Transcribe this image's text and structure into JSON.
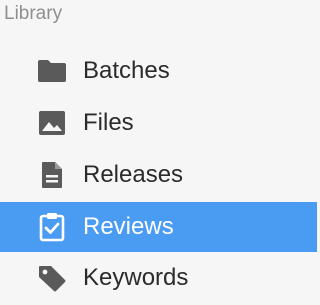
{
  "sidebar": {
    "section_title": "Library",
    "items": [
      {
        "label": "Batches",
        "icon": "folder-icon",
        "selected": false
      },
      {
        "label": "Files",
        "icon": "image-icon",
        "selected": false
      },
      {
        "label": "Releases",
        "icon": "document-icon",
        "selected": false
      },
      {
        "label": "Reviews",
        "icon": "clipboard-check-icon",
        "selected": true
      },
      {
        "label": "Keywords",
        "icon": "tag-icon",
        "selected": false
      }
    ]
  },
  "colors": {
    "background": "#f6f6f6",
    "selection": "#4a9bf2",
    "icon": "#5a5a5a",
    "text": "#2b2b2b",
    "section_title": "#8f8f8f"
  }
}
